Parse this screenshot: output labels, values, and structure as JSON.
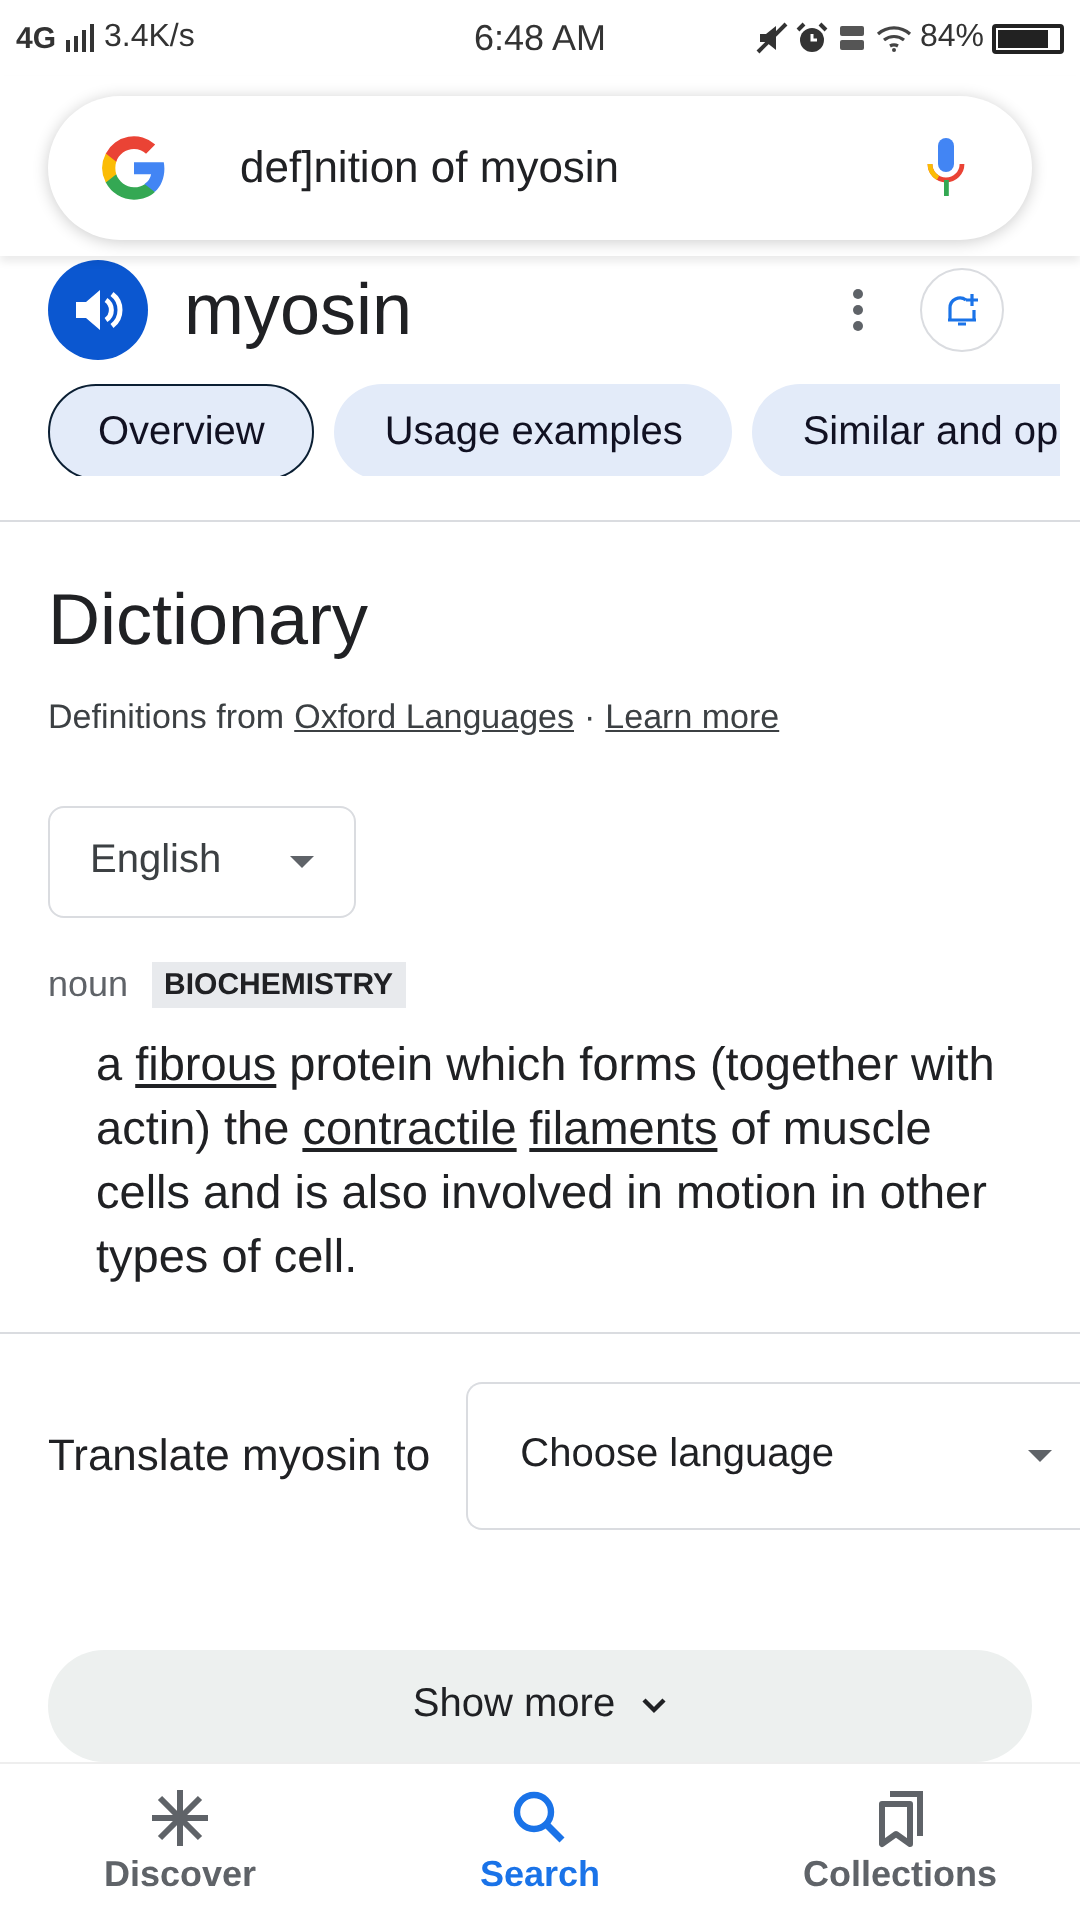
{
  "status_bar": {
    "network": "4G",
    "speed": "3.4K/s",
    "time": "6:48 AM",
    "battery": "84%"
  },
  "search": {
    "value": "def]nition of myosin"
  },
  "word": {
    "title": "myosin"
  },
  "chips": [
    {
      "label": "Overview",
      "selected": true,
      "cut": false
    },
    {
      "label": "Usage examples",
      "selected": false,
      "cut": false
    },
    {
      "label": "Similar and op",
      "selected": false,
      "cut": true
    }
  ],
  "dictionary": {
    "title": "Dictionary",
    "source_prefix": "Definitions from",
    "source_link": "Oxford Languages",
    "separator": "·",
    "learn_more": "Learn more",
    "language": "English",
    "part_of_speech": "noun",
    "domain": "BIOCHEMISTRY",
    "definition": [
      {
        "text": "a ",
        "link": false
      },
      {
        "text": "fibrous",
        "link": true
      },
      {
        "text": " protein which forms (together with actin) the ",
        "link": false
      },
      {
        "text": "contractile",
        "link": true
      },
      {
        "text": "filaments",
        "link": true
      },
      {
        "text": " of muscle cells and is also involved in motion in other types of cell.",
        "link": false
      }
    ]
  },
  "translate": {
    "label": "Translate myosin to",
    "placeholder": "Choose language"
  },
  "show_more": "Show more",
  "bottom_nav": [
    {
      "label": "Discover",
      "kind": "discover",
      "selected": false
    },
    {
      "label": "Search",
      "kind": "search",
      "selected": true
    },
    {
      "label": "Collections",
      "kind": "collections",
      "selected": false
    }
  ]
}
